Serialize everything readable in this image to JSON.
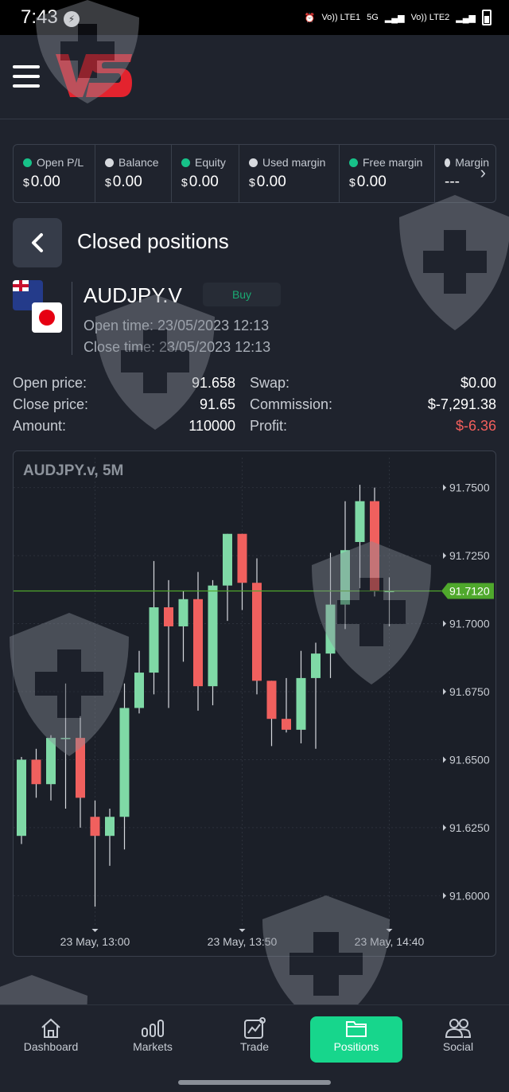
{
  "status_bar": {
    "time": "7:43",
    "msg_icon": "messenger-icon",
    "network1": "Vo)) LTE1",
    "network_5g": "5G",
    "network2": "Vo)) LTE2"
  },
  "header": {
    "menu_icon": "hamburger-icon",
    "logo": "vs-logo"
  },
  "account": {
    "items": [
      {
        "label": "Open P/L",
        "currency": "$",
        "value": "0.00",
        "dot": "green"
      },
      {
        "label": "Balance",
        "currency": "$",
        "value": "0.00",
        "dot": "white"
      },
      {
        "label": "Equity",
        "currency": "$",
        "value": "0.00",
        "dot": "green"
      },
      {
        "label": "Used margin",
        "currency": "$",
        "value": "0.00",
        "dot": "white"
      },
      {
        "label": "Free margin",
        "currency": "$",
        "value": "0.00",
        "dot": "green"
      },
      {
        "label": "Margin",
        "currency": "",
        "value": "---",
        "dot": "white"
      }
    ]
  },
  "page": {
    "title": "Closed positions"
  },
  "position": {
    "symbol": "AUDJPY.V",
    "side": "Buy",
    "open_time": "Open time: 23/05/2023 12:13",
    "close_time": "Close time: 23/05/2023 12:13",
    "open_price_label": "Open price:",
    "open_price": "91.658",
    "close_price_label": "Close price:",
    "close_price": "91.65",
    "amount_label": "Amount:",
    "amount": "110000",
    "swap_label": "Swap:",
    "swap": "$0.00",
    "commission_label": "Commission:",
    "commission": "$-7,291.38",
    "profit_label": "Profit:",
    "profit": "$-6.36"
  },
  "colors": {
    "up": "#7fd9a6",
    "down": "#f0605e",
    "accent": "#17d68c",
    "current_price": "#4fa82c"
  },
  "chart_data": {
    "type": "candlestick",
    "title": "AUDJPY.v, 5M",
    "y_ticks": [
      "91.7500",
      "91.7250",
      "91.7000",
      "91.6750",
      "91.6500",
      "91.6250",
      "91.6000"
    ],
    "ylim": [
      91.589,
      91.761
    ],
    "current_price": 91.712,
    "current_price_label": "91.7120",
    "x_ticks": [
      {
        "label": "23 May, 13:00",
        "index": 5
      },
      {
        "label": "23 May, 13:50",
        "index": 15
      },
      {
        "label": "23 May, 14:40",
        "index": 25
      }
    ],
    "candles": [
      {
        "o": 91.622,
        "h": 91.651,
        "l": 91.619,
        "c": 91.65
      },
      {
        "o": 91.65,
        "h": 91.654,
        "l": 91.636,
        "c": 91.641
      },
      {
        "o": 91.641,
        "h": 91.659,
        "l": 91.635,
        "c": 91.658
      },
      {
        "o": 91.658,
        "h": 91.678,
        "l": 91.632,
        "c": 91.658
      },
      {
        "o": 91.658,
        "h": 91.666,
        "l": 91.625,
        "c": 91.636
      },
      {
        "o": 91.629,
        "h": 91.635,
        "l": 91.596,
        "c": 91.622
      },
      {
        "o": 91.622,
        "h": 91.632,
        "l": 91.611,
        "c": 91.629
      },
      {
        "o": 91.629,
        "h": 91.678,
        "l": 91.617,
        "c": 91.669
      },
      {
        "o": 91.669,
        "h": 91.69,
        "l": 91.667,
        "c": 91.682
      },
      {
        "o": 91.682,
        "h": 91.723,
        "l": 91.674,
        "c": 91.706
      },
      {
        "o": 91.706,
        "h": 91.716,
        "l": 91.669,
        "c": 91.699
      },
      {
        "o": 91.699,
        "h": 91.712,
        "l": 91.686,
        "c": 91.709
      },
      {
        "o": 91.709,
        "h": 91.719,
        "l": 91.668,
        "c": 91.677
      },
      {
        "o": 91.677,
        "h": 91.716,
        "l": 91.67,
        "c": 91.714
      },
      {
        "o": 91.714,
        "h": 91.733,
        "l": 91.701,
        "c": 91.733
      },
      {
        "o": 91.733,
        "h": 91.733,
        "l": 91.705,
        "c": 91.715
      },
      {
        "o": 91.715,
        "h": 91.724,
        "l": 91.674,
        "c": 91.679
      },
      {
        "o": 91.679,
        "h": 91.679,
        "l": 91.655,
        "c": 91.665
      },
      {
        "o": 91.665,
        "h": 91.68,
        "l": 91.66,
        "c": 91.661
      },
      {
        "o": 91.661,
        "h": 91.69,
        "l": 91.656,
        "c": 91.68
      },
      {
        "o": 91.68,
        "h": 91.693,
        "l": 91.654,
        "c": 91.689
      },
      {
        "o": 91.689,
        "h": 91.726,
        "l": 91.68,
        "c": 91.707
      },
      {
        "o": 91.707,
        "h": 91.745,
        "l": 91.698,
        "c": 91.727
      },
      {
        "o": 91.73,
        "h": 91.751,
        "l": 91.713,
        "c": 91.745
      },
      {
        "o": 91.745,
        "h": 91.75,
        "l": 91.71,
        "c": 91.712
      },
      {
        "o": 91.712,
        "h": 91.717,
        "l": 91.699,
        "c": 91.712
      }
    ]
  },
  "nav": {
    "items": [
      {
        "label": "Dashboard",
        "icon": "home-icon"
      },
      {
        "label": "Markets",
        "icon": "markets-icon"
      },
      {
        "label": "Trade",
        "icon": "trade-icon"
      },
      {
        "label": "Positions",
        "icon": "folder-icon",
        "active": true
      },
      {
        "label": "Social",
        "icon": "social-icon"
      }
    ]
  }
}
